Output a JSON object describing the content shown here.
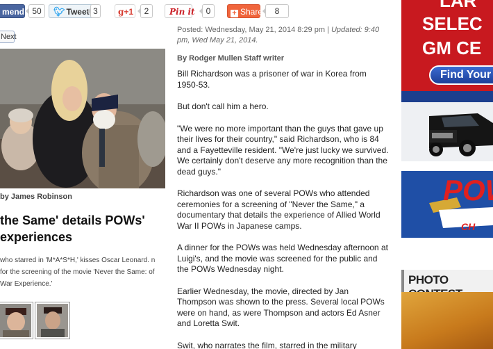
{
  "social": {
    "facebook": {
      "label": "mend",
      "count": "50"
    },
    "twitter": {
      "label": "Tweet",
      "count": "3"
    },
    "googleplus": {
      "label": "+1",
      "count": "2"
    },
    "pinterest": {
      "label": "Pin it",
      "count": "0"
    },
    "share": {
      "label": "Share",
      "count": "8"
    }
  },
  "gallery": {
    "next_label": "Next",
    "credit": "by James Robinson",
    "headline": "the Same' details POWs' experiences",
    "caption": "who starred in 'M*A*S*H,' kisses Oscar Leonard. n for the screening of the movie 'Never the Same: of War Experience.'"
  },
  "article": {
    "posted": "Posted: Wednesday, May 21, 2014 8:29 pm |",
    "updated": "Updated: 9:40 pm, Wed May 21, 2014.",
    "byline": "By Rodger Mullen Staff writer",
    "paragraphs": [
      "Bill Richardson was a prisoner of war in Korea from 1950-53.",
      "But don't call him a hero.",
      "\"We were no more important than the guys that gave up their lives for their country,\" said Richardson, who is 84 and a Fayetteville resident. \"We're just lucky we survived. We certainly don't deserve any more recognition than the dead guys.\"",
      "Richardson was one of several POWs who attended ceremonies for a screening of \"Never the Same,\" a documentary that details the experience of Allied World War II POWs in Japanese camps.",
      "A dinner for the POWs was held Wednesday afternoon at Luigi's, and the movie was screened for the public and the POWs Wednesday night.",
      "Earlier Wednesday, the movie, directed by Jan Thompson was shown to the press. Several local POWs were on hand, as were Thompson and actors Ed Asner and Loretta Swit.",
      "Swit, who narrates the film, starred in the military"
    ]
  },
  "ads": {
    "top_line1": "LAR",
    "top_line2": "SELEC",
    "top_line3": "GM CE",
    "find_button": "Find Your",
    "pow_text": "POW",
    "pow_sub": "CH"
  },
  "photo_contest": {
    "label": "PHOTO CONTEST"
  }
}
